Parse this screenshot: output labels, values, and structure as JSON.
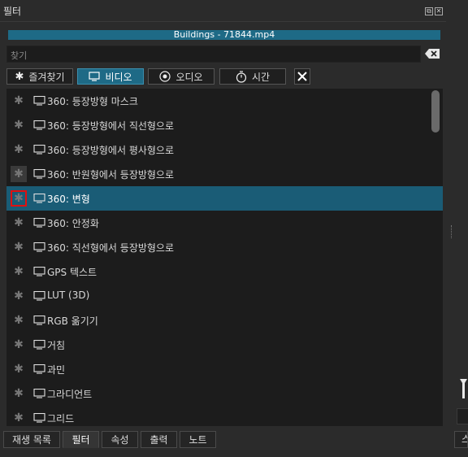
{
  "window": {
    "title": "필터"
  },
  "current_file": "Buildings - 71844.mp4",
  "search": {
    "placeholder": "찾기"
  },
  "category_tabs": [
    {
      "label": "즐겨찾기",
      "icon": "star-icon",
      "active": false
    },
    {
      "label": "비디오",
      "icon": "monitor-icon",
      "active": true
    },
    {
      "label": "오디오",
      "icon": "speaker-icon",
      "active": false
    },
    {
      "label": "시간",
      "icon": "stopwatch-icon",
      "active": false
    }
  ],
  "filters": [
    {
      "label": "360: 등장방형 마스크"
    },
    {
      "label": "360: 등장방형에서 직선형으로"
    },
    {
      "label": "360: 등장방형에서 평사형으로"
    },
    {
      "label": "360: 반원형에서 등장방형으로"
    },
    {
      "label": "360: 변형",
      "selected": true
    },
    {
      "label": "360: 안정화"
    },
    {
      "label": "360: 직선형에서 등장방형으로"
    },
    {
      "label": "GPS 텍스트"
    },
    {
      "label": "LUT (3D)"
    },
    {
      "label": "RGB 옮기기"
    },
    {
      "label": "거침"
    },
    {
      "label": "과민"
    },
    {
      "label": "그라디언트"
    },
    {
      "label": "그리드"
    }
  ],
  "bottom_tabs": [
    {
      "label": "재생 목록"
    },
    {
      "label": "필터",
      "active": true
    },
    {
      "label": "속성"
    },
    {
      "label": "출력"
    },
    {
      "label": "노트"
    }
  ],
  "bottom_tab_partial": "스",
  "colors": {
    "accent": "#1e6a86",
    "selected_row": "#1a5c76",
    "highlight": "#e01010"
  }
}
